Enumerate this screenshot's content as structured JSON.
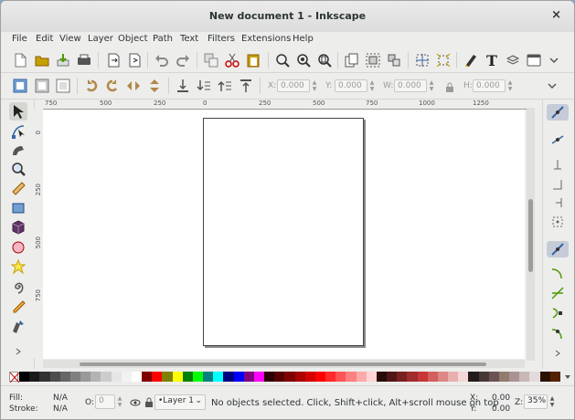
{
  "window": {
    "title": "New document 1 - Inkscape",
    "close_glyph": "×"
  },
  "menu": [
    "File",
    "Edit",
    "View",
    "Layer",
    "Object",
    "Path",
    "Text",
    "Filters",
    "Extensions",
    "Help"
  ],
  "commands_toolbar": {
    "icons": [
      "new-icon",
      "open-icon",
      "import-icon",
      "print-icon",
      "export-icon",
      "export-bitmap-icon",
      "undo-icon",
      "redo-icon",
      "duplicate-icon",
      "cut-icon",
      "paste-icon",
      "zoom-selection-icon",
      "zoom-drawing-icon",
      "zoom-page-icon",
      "clone-icon",
      "group-icon",
      "ungroup-icon",
      "fill-stroke-icon",
      "xml-editor-icon",
      "text-font-icon",
      "layers-icon",
      "preferences-icon"
    ]
  },
  "tool_controls": {
    "x_label": "X:",
    "x_value": "0.000",
    "y_label": "Y:",
    "y_value": "0.000",
    "w_label": "W:",
    "w_value": "0.000",
    "h_label": "H:",
    "h_value": "0.000"
  },
  "ruler": {
    "top_labels": [
      "750",
      "500",
      "250",
      "0",
      "250",
      "500",
      "750",
      "1000",
      "1250"
    ],
    "left_labels": [
      "0",
      "250",
      "500",
      "750"
    ]
  },
  "tools": [
    "selector-tool",
    "node-tool",
    "tweak-tool",
    "zoom-tool",
    "measure-tool",
    "rect-tool",
    "3dbox-tool",
    "ellipse-tool",
    "star-tool",
    "spiral-tool",
    "pencil-tool",
    "pen-tool"
  ],
  "snap_toolbar": [
    "snap-enable",
    "snap-bbox",
    "snap-bbox-edge",
    "snap-bbox-corner",
    "snap-bbox-midpoint",
    "snap-bbox-center",
    "snap-nodes",
    "snap-path",
    "snap-path-intersection",
    "snap-cusp-node",
    "snap-smooth-node"
  ],
  "palette": {
    "colors": [
      "#000000",
      "#1a1a1a",
      "#333333",
      "#4d4d4d",
      "#666666",
      "#808080",
      "#999999",
      "#b3b3b3",
      "#cccccc",
      "#e6e6e6",
      "#f2f2f2",
      "#ffffff",
      "#800000",
      "#ff0000",
      "#808000",
      "#ffff00",
      "#008000",
      "#00ff00",
      "#008080",
      "#00ffff",
      "#000080",
      "#0000ff",
      "#800080",
      "#ff00ff",
      "#2b0000",
      "#550000",
      "#800000",
      "#aa0000",
      "#d40000",
      "#ff0000",
      "#ff2a2a",
      "#ff5555",
      "#ff8080",
      "#ffaaaa",
      "#ffd5d5",
      "#280b0b",
      "#501616",
      "#782121",
      "#a02c2c",
      "#c83737",
      "#d35f5f",
      "#de8787",
      "#e9afaf",
      "#f4d7d7",
      "#241c1c",
      "#483737",
      "#6c5353",
      "#917c6f",
      "#ac9393",
      "#c8b7b7",
      "#e3dbdb",
      "#2b1100",
      "#552200"
    ]
  },
  "status": {
    "fill_label": "Fill:",
    "fill_value": "N/A",
    "stroke_label": "Stroke:",
    "stroke_value": "N/A",
    "opacity_label": "O:",
    "opacity_value": "0",
    "layer": "•Layer 1",
    "message": "No objects selected. Click, Shift+click, Alt+scroll mouse on top",
    "x_label": "X:",
    "x_value": "0.00",
    "y_label": "Y:",
    "y_value": "0.00",
    "z_label": "Z:",
    "zoom_value": "35%"
  }
}
